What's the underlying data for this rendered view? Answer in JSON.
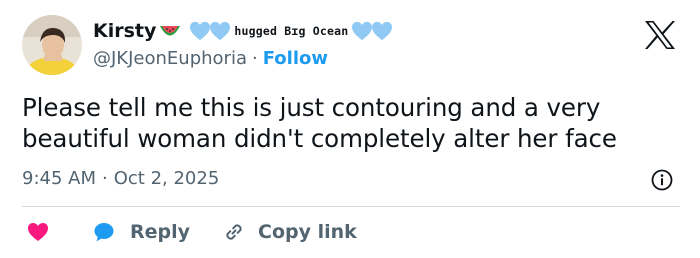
{
  "author": {
    "display_name": "Kirsty",
    "name_decoration": "hugged Bɪg Ocean",
    "handle": "@JKJeonEuphoria",
    "follow_label": "Follow"
  },
  "tweet": {
    "text": "Please tell me this is just contouring and a very beautiful woman didn't completely alter her face",
    "time": "9:45 AM",
    "date": "Oct 2, 2025"
  },
  "actions": {
    "reply_label": "Reply",
    "copy_link_label": "Copy link"
  },
  "icons": {
    "avatar": "avatar",
    "watermelon": "watermelon-emoji-icon",
    "heart_decoration": "light-blue-heart-icon",
    "x_logo": "x-logo-icon",
    "info": "info-icon",
    "like": "heart-icon",
    "reply": "speech-bubble-icon",
    "copy_link": "link-icon"
  },
  "colors": {
    "text": "#0f1419",
    "secondary": "#536471",
    "accent": "#1d9bf0",
    "like": "#f91880",
    "heart_decoration": "#8fc9f4",
    "divider": "#cfd9de"
  }
}
